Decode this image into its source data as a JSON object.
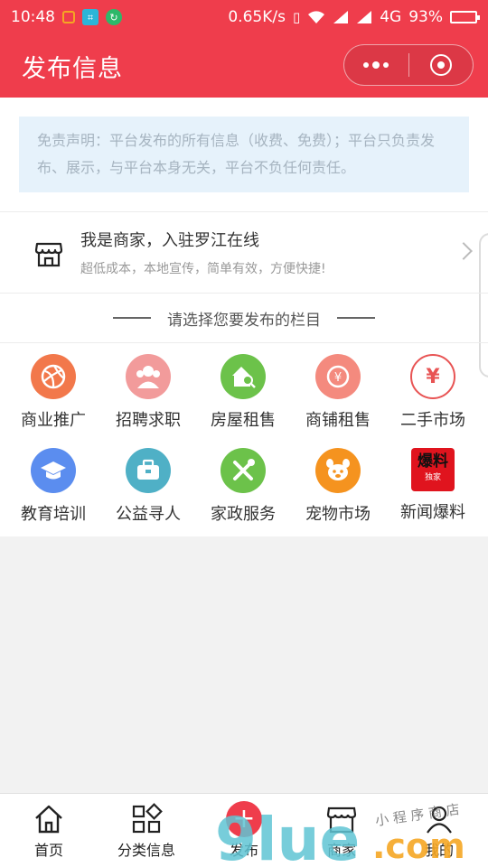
{
  "status_bar": {
    "time": "10:48",
    "network_speed": "0.65K/s",
    "network_type": "4G",
    "battery": "93%",
    "battery_level": 0.93
  },
  "header": {
    "title": "发布信息"
  },
  "disclaimer": {
    "text": "免责声明：平台发布的所有信息（收费、免费）；平台只负责发布、展示，与平台本身无关，平台不负任何责任。"
  },
  "merchant": {
    "title": "我是商家，入驻罗江在线",
    "subtitle": "超低成本，本地宣传，简单有效，方便快捷!"
  },
  "section": {
    "title": "请选择您要发布的栏目"
  },
  "categories": [
    {
      "label": "商业推广",
      "icon": "volleyball-icon",
      "color": "#f2784b"
    },
    {
      "label": "招聘求职",
      "icon": "people-icon",
      "color": "#f29b9b"
    },
    {
      "label": "房屋租售",
      "icon": "house-search-icon",
      "color": "#6cc24a"
    },
    {
      "label": "商铺租售",
      "icon": "shop-tag-icon",
      "color": "#f48a7e"
    },
    {
      "label": "二手市场",
      "icon": "yen-icon",
      "color": "#e85454"
    },
    {
      "label": "教育培训",
      "icon": "graduation-cap-icon",
      "color": "#5b8def"
    },
    {
      "label": "公益寻人",
      "icon": "briefcase-icon",
      "color": "#4fb0c6"
    },
    {
      "label": "家政服务",
      "icon": "tools-icon",
      "color": "#6cc24a"
    },
    {
      "label": "宠物市场",
      "icon": "pet-icon",
      "color": "#f5931f"
    },
    {
      "label": "新闻爆料",
      "icon": "news-tip-icon",
      "color": "#e0141e",
      "badge_main": "爆料",
      "badge_sub": "独家"
    }
  ],
  "tabbar": {
    "items": [
      {
        "label": "首页",
        "icon": "home-icon"
      },
      {
        "label": "分类信息",
        "icon": "category-grid-icon"
      },
      {
        "label": "发布",
        "icon": "plus-icon"
      },
      {
        "label": "商家",
        "icon": "store-icon"
      },
      {
        "label": "我的",
        "icon": "user-icon"
      }
    ]
  },
  "colors": {
    "brand_red": "#ef3d4c",
    "disclaimer_bg": "#e6f2fb",
    "disclaimer_text": "#a6b4c0"
  }
}
